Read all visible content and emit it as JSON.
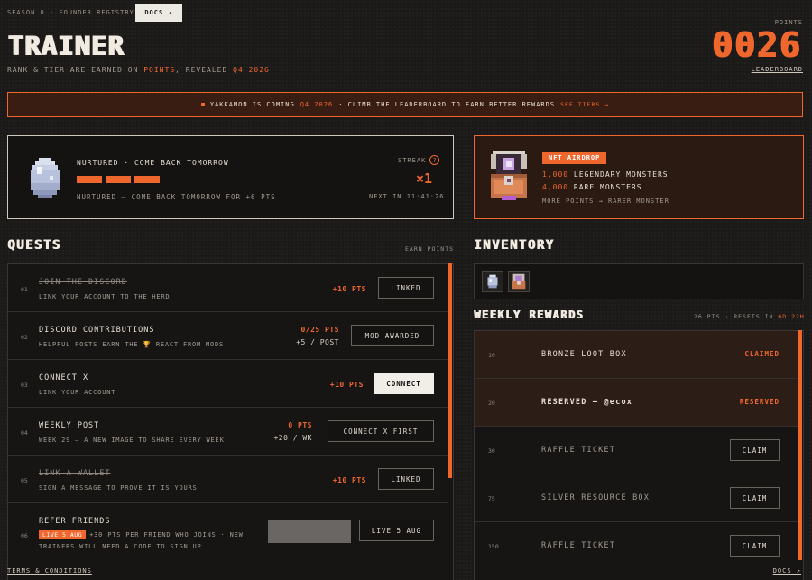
{
  "header": {
    "season": "SEASON 0 · FOUNDER REGISTRY",
    "docs_button": "DOCS ↗",
    "title": "TRAINER",
    "subtitle_prefix": "RANK & TIER ARE EARNED ON ",
    "subtitle_points": "POINTS",
    "subtitle_mid": ", REVEALED ",
    "subtitle_date": "Q4 2026",
    "points_label": "POINTS",
    "points_value": "0026",
    "leaderboard_link": "LEADERBOARD"
  },
  "banner": {
    "text1": "YAKKAMON IS COMING",
    "date": "Q4 2026",
    "text2": "· CLIMB THE LEADERBOARD TO EARN BETTER REWARDS",
    "link": "SEE TIERS →"
  },
  "nurture": {
    "title": "NURTURED · COME BACK TOMORROW",
    "progress_filled": 3,
    "subtitle": "NURTURED — COME BACK TOMORROW FOR +6 PTS",
    "streak_label": "STREAK",
    "streak_icon": "?",
    "streak_value": "×1",
    "next_in": "NEXT IN 11:41:26"
  },
  "airdrop": {
    "badge": "NFT AIRDROP",
    "line1_count": "1,000",
    "line1_text": "LEGENDARY MONSTERS",
    "line2_count": "4,000",
    "line2_text": "RARE MONSTERS",
    "line3": "MORE POINTS → RARER MONSTER"
  },
  "quests": {
    "title": "QUESTS",
    "earn_label": "EARN POINTS",
    "items": [
      {
        "num": "01",
        "title": "JOIN THE DISCORD",
        "sub": "LINK YOUR ACCOUNT TO THE HERD",
        "pts": "+10 PTS",
        "pts2": "",
        "button": "LINKED"
      },
      {
        "num": "02",
        "title": "DISCORD CONTRIBUTIONS",
        "sub": "HELPFUL POSTS EARN THE 🏆 REACT FROM MODS",
        "pts": "0/25 PTS",
        "pts2": "+5 / POST",
        "button": "MOD AWARDED"
      },
      {
        "num": "03",
        "title": "CONNECT X",
        "sub": "LINK YOUR ACCOUNT",
        "pts": "+10 PTS",
        "pts2": "",
        "button": "CONNECT"
      },
      {
        "num": "04",
        "title": "WEEKLY POST",
        "sub": "WEEK 29 — A NEW IMAGE TO SHARE EVERY WEEK",
        "pts": "0 PTS",
        "pts2": "+20 / WK",
        "button": "CONNECT X FIRST"
      },
      {
        "num": "05",
        "title": "LINK A WALLET",
        "sub": "SIGN A MESSAGE TO PROVE IT IS YOURS",
        "pts": "+10 PTS",
        "pts2": "",
        "button": "LINKED"
      },
      {
        "num": "06",
        "title": "REFER FRIENDS",
        "badge": "LIVE 5 AUG",
        "sub": "+30 PTS PER FRIEND WHO JOINS · NEW",
        "sub2": "TRAINERS WILL NEED A CODE TO SIGN UP",
        "pts": "",
        "pts2": "",
        "button": "LIVE 5 AUG"
      }
    ]
  },
  "inventory": {
    "title": "INVENTORY"
  },
  "weekly": {
    "title": "WEEKLY REWARDS",
    "meta_prefix": "26 PTS · RESETS IN ",
    "meta_time": "6D 22H",
    "items": [
      {
        "num": "10",
        "title": "BRONZE LOOT BOX",
        "status": "CLAIMED",
        "button": ""
      },
      {
        "num": "20",
        "title": "RESERVED — @ecox",
        "status": "RESERVED",
        "button": ""
      },
      {
        "num": "30",
        "title": "RAFFLE TICKET",
        "status": "",
        "button": "CLAIM"
      },
      {
        "num": "75",
        "title": "SILVER RESOURCE BOX",
        "status": "",
        "button": "CLAIM"
      },
      {
        "num": "150",
        "title": "RAFFLE TICKET",
        "status": "",
        "button": "CLAIM"
      }
    ]
  },
  "footer": {
    "terms": "TERMS & CONDITIONS",
    "docs": "DOCS ↗"
  },
  "colors": {
    "accent": "#f0672e",
    "background": "#1c1a19",
    "text": "#e4ddd2"
  }
}
